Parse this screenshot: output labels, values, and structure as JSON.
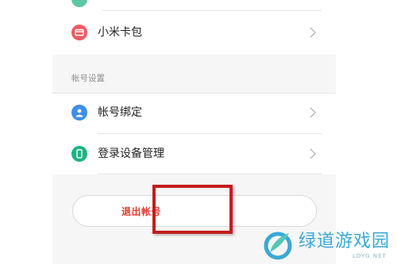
{
  "menu": {
    "card_package": {
      "label": "小米卡包",
      "icon": "card-icon",
      "icon_color": "#ef5a63"
    }
  },
  "account_section": {
    "title": "帐号设置",
    "items": [
      {
        "label": "帐号绑定",
        "icon": "person-icon",
        "icon_color": "#3d8ee8"
      },
      {
        "label": "登录设备管理",
        "icon": "phone-icon",
        "icon_color": "#1db383"
      }
    ]
  },
  "logout": {
    "label": "退出帐号",
    "color": "#e03a2f"
  },
  "highlight_color": "#c41d1d",
  "watermark": {
    "text": "绿道游戏园",
    "sub": "LDYG.NET",
    "color": "#39a8d6"
  }
}
